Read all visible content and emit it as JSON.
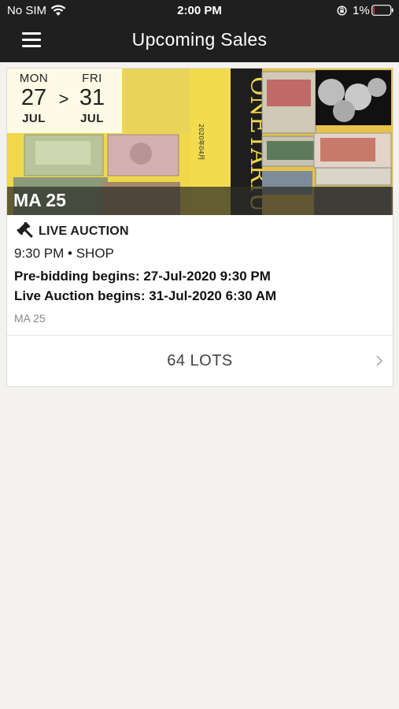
{
  "status_bar": {
    "carrier": "No SIM",
    "time": "2:00 PM",
    "battery": "1%"
  },
  "nav": {
    "title": "Upcoming Sales",
    "icon": "menu-icon"
  },
  "sale": {
    "start": {
      "dow": "MON",
      "day": "27",
      "month": "JUL"
    },
    "arrow": ">",
    "end": {
      "dow": "FRI",
      "day": "31",
      "month": "JUL"
    },
    "code": "MA 25",
    "type": "LIVE AUCTION",
    "type_icon": "gavel-icon",
    "time_location": "9:30 PM • SHOP",
    "prebidding": "Pre-bidding begins: 27-Jul-2020 9:30 PM",
    "live_begins": "Live Auction begins: 31-Jul-2020 6:30 AM",
    "subcode": "MA 25",
    "lots_label": "64 LOTS"
  },
  "colors": {
    "topbar": "#1f1f1f",
    "background": "#f3f2ee",
    "banner_yellow": "#f0d84a"
  }
}
